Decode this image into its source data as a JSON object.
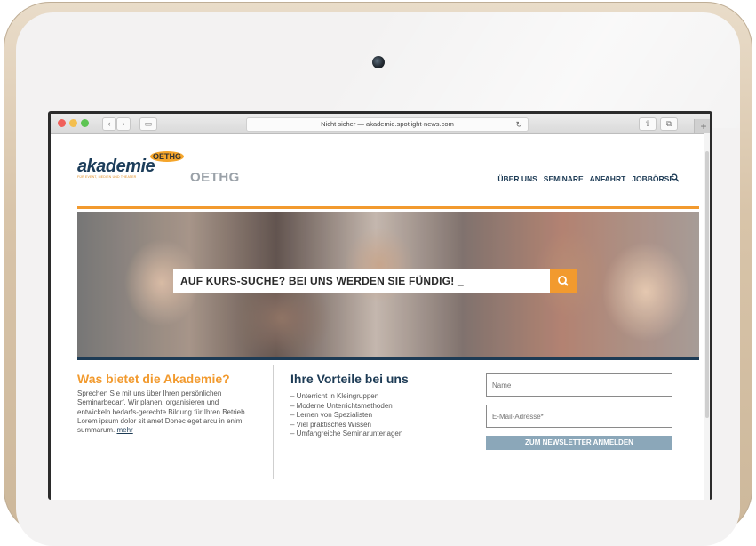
{
  "browser": {
    "address": "Nicht sicher — akademie.spotlight-news.com",
    "reload_icon": "reload-icon",
    "new_tab": "+"
  },
  "site": {
    "logo_text": "akademie",
    "logo_badge": "OETHG",
    "logo_sub": "FÜR EVENT, MEDIEN UND THEATER",
    "oethg": "OETHG",
    "nav": [
      "ÜBER UNS",
      "SEMINARE",
      "ANFAHRT",
      "JOBBÖRSE"
    ],
    "colors": {
      "orange": "#f29a2e",
      "navy": "#1d3b55",
      "button": "#8ba7b9"
    }
  },
  "hero": {
    "search_text": "AUF KURS-SUCHE? BEI UNS WERDEN SIE FÜNDIG! _"
  },
  "info": {
    "title": "Was bietet die Akademie?",
    "text": "Sprechen Sie mit uns über Ihren persönlichen Seminarbedarf. Wir planen, organisieren und entwickeln bedarfs-gerechte Bildung für Ihren Betrieb. Lorem ipsum dolor sit amet Donec eget arcu in enim summarum.",
    "more": "mehr"
  },
  "benefits": {
    "title": "Ihre Vorteile bei uns",
    "items": [
      "Unterricht in Kleingruppen",
      "Moderne Unterrichtsmethoden",
      "Lernen von Spezialisten",
      "Viel praktisches Wissen",
      "Umfangreiche Seminarunterlagen"
    ]
  },
  "newsletter": {
    "name_placeholder": "Name",
    "email_placeholder": "E-Mail-Adresse*",
    "button": "ZUM NEWSLETTER ANMELDEN"
  }
}
